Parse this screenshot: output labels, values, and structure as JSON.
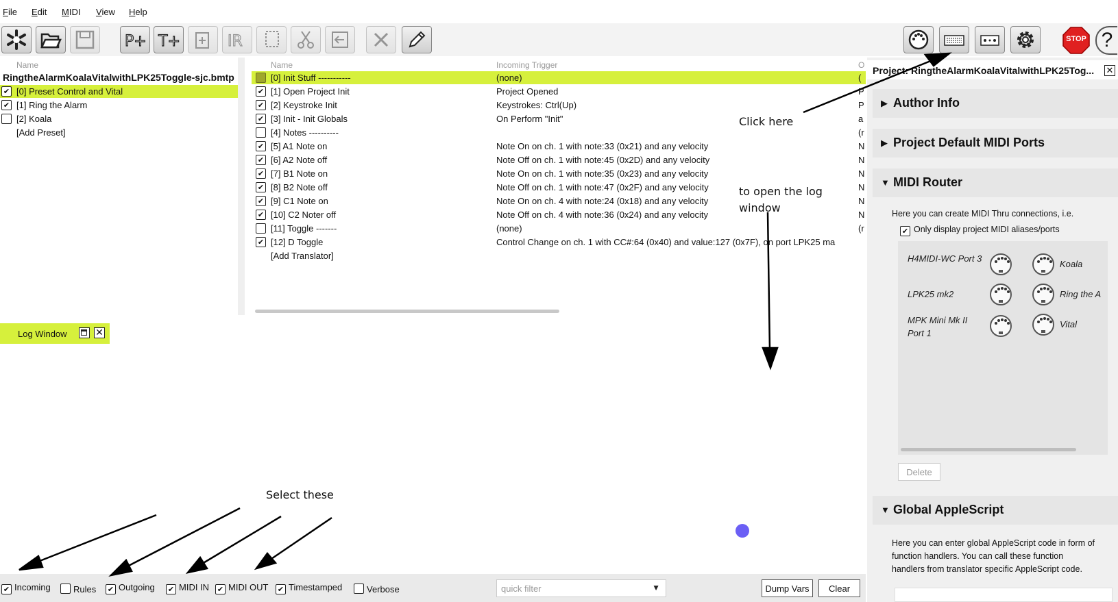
{
  "menu": [
    "File",
    "Edit",
    "MIDI",
    "View",
    "Help"
  ],
  "toolbar": {
    "buttons": [
      "new-preset",
      "open",
      "save",
      "add-preset",
      "add-translator",
      "duplicate",
      "rename",
      "copy",
      "cut",
      "paste",
      "delete",
      "edit"
    ],
    "stop_label": "STOP",
    "help_label": "?"
  },
  "presets": {
    "column_header": "Name",
    "project_file": "RingtheAlarmKoalaVitalwithLPK25Toggle-sjc.bmtp",
    "items": [
      {
        "label": "[0] Preset Control and Vital",
        "checked": true
      },
      {
        "label": "[1] Ring the Alarm",
        "checked": true
      },
      {
        "label": "[2] Koala",
        "checked": false
      }
    ],
    "add_label": "[Add Preset]"
  },
  "translators": {
    "headers": {
      "name": "Name",
      "trigger": "Incoming Trigger",
      "outgoing": "O"
    },
    "rows": [
      {
        "name": "[0] Init Stuff -----------",
        "trigger": "(none)",
        "out": "(",
        "checked": true
      },
      {
        "name": "[1] Open Project Init",
        "trigger": "Project Opened",
        "out": "P",
        "checked": true
      },
      {
        "name": "[2] Keystroke Init",
        "trigger": "Keystrokes: Ctrl(Up)",
        "out": "P",
        "checked": true
      },
      {
        "name": "[3] Init - Init Globals",
        "trigger": "On Perform \"Init\"",
        "out": "a",
        "checked": true
      },
      {
        "name": "[4] Notes ----------",
        "trigger": "",
        "out": "(r",
        "checked": false
      },
      {
        "name": "[5] A1 Note on",
        "trigger": "Note On on ch. 1 with note:33 (0x21) and any velocity",
        "out": "N",
        "checked": true
      },
      {
        "name": "[6] A2 Note off",
        "trigger": "Note Off on ch. 1 with note:45 (0x2D) and any velocity",
        "out": "N",
        "checked": true
      },
      {
        "name": "[7] B1 Note on",
        "trigger": "Note On on ch. 1 with note:35 (0x23) and any velocity",
        "out": "N",
        "checked": true
      },
      {
        "name": "[8] B2 Note off",
        "trigger": "Note Off on ch. 1 with note:47 (0x2F) and any velocity",
        "out": "N",
        "checked": true
      },
      {
        "name": "[9] C1 Note on",
        "trigger": "Note On on ch. 4 with note:24 (0x18) and any velocity",
        "out": "N",
        "checked": true
      },
      {
        "name": "[10] C2 Noter off",
        "trigger": "Note Off on ch. 4 with note:36 (0x24) and any velocity",
        "out": "N",
        "checked": true
      },
      {
        "name": "[11] Toggle -------",
        "trigger": "(none)",
        "out": "(r",
        "checked": false
      },
      {
        "name": "[12] D Toggle",
        "trigger": "Control Change on ch. 1 with CC#:64 (0x40) and value:127 (0x7F), on port LPK25 ma",
        "out": "",
        "checked": true
      }
    ],
    "add_label": "[Add Translator]"
  },
  "log": {
    "title": "Log Window",
    "filters": [
      {
        "label": "Incoming",
        "checked": true
      },
      {
        "label": "Rules",
        "checked": false
      },
      {
        "label": "Outgoing",
        "checked": true
      },
      {
        "label": "MIDI IN",
        "checked": true
      },
      {
        "label": "MIDI OUT",
        "checked": true
      },
      {
        "label": "Timestamped",
        "checked": true
      },
      {
        "label": "Verbose",
        "checked": false
      }
    ],
    "quick_filter_placeholder": "quick filter",
    "dump_vars_label": "Dump Vars",
    "clear_label": "Clear"
  },
  "project": {
    "title": "Project: RingtheAlarmKoalaVitalwithLPK25Tog...",
    "sections": {
      "author": "Author Info",
      "ports": "Project Default MIDI Ports",
      "router": "MIDI Router",
      "applescript": "Global AppleScript"
    },
    "router_desc": "Here you can create MIDI Thru connections, i.e.",
    "only_display_label": "Only display project MIDI aliases/ports",
    "in_ports": [
      "H4MIDI-WC Port 3",
      "LPK25 mk2",
      "MPK Mini Mk II Port 1"
    ],
    "out_ports": [
      "Koala",
      "Ring the A",
      "Vital"
    ],
    "delete_label": "Delete",
    "applescript_desc": "Here you can enter global AppleScript code in form of function handlers. You can call these function handlers from translator specific AppleScript code."
  },
  "annotations": {
    "click_here": "Click here",
    "open_log": "to open the log window",
    "select_these": "Select these"
  },
  "colors": {
    "selection": "#d6f03c",
    "stop": "#e02020",
    "cursor_dot": "#6b5ff5"
  }
}
